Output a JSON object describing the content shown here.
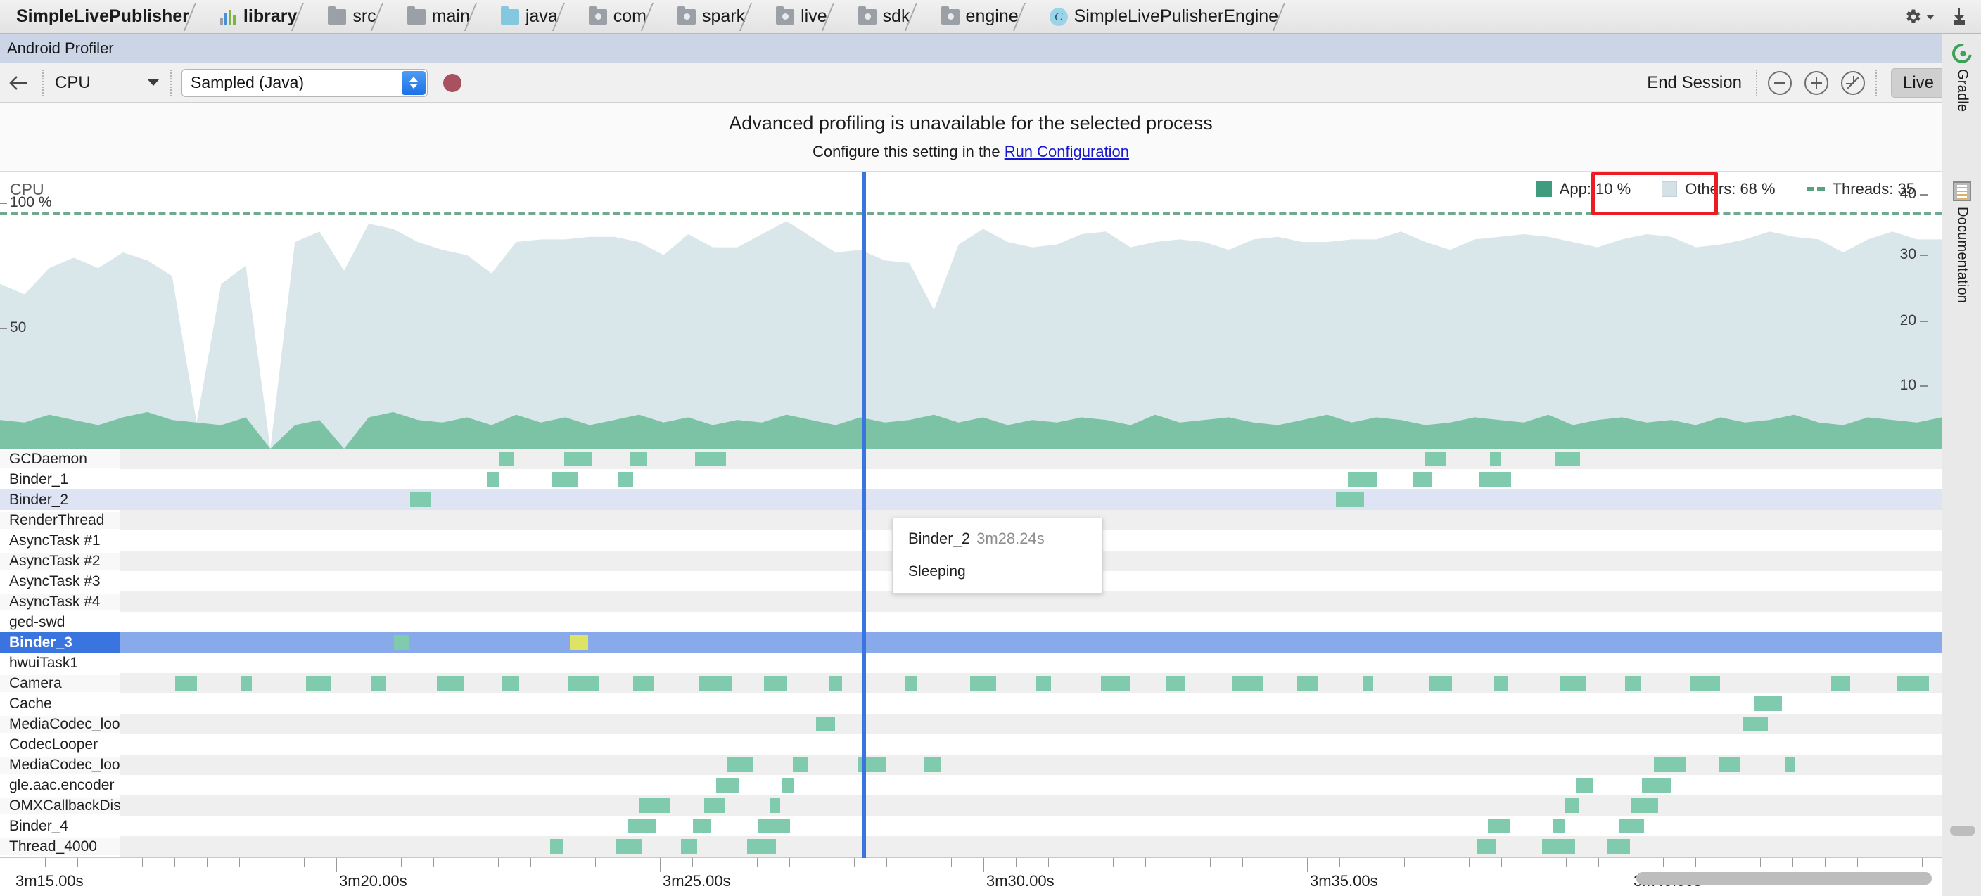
{
  "breadcrumb": [
    {
      "label": "SimpleLivePublisher",
      "icon": "module-icon",
      "bold": true
    },
    {
      "label": "library",
      "icon": "chart-icon",
      "bold": true
    },
    {
      "label": "src",
      "icon": "folder-icon",
      "bold": false
    },
    {
      "label": "main",
      "icon": "folder-icon",
      "bold": false
    },
    {
      "label": "java",
      "icon": "folder-blue-icon",
      "bold": false
    },
    {
      "label": "com",
      "icon": "package-icon",
      "bold": false
    },
    {
      "label": "spark",
      "icon": "package-icon",
      "bold": false
    },
    {
      "label": "live",
      "icon": "package-icon",
      "bold": false
    },
    {
      "label": "sdk",
      "icon": "package-icon",
      "bold": false
    },
    {
      "label": "engine",
      "icon": "package-icon",
      "bold": false
    },
    {
      "label": "SimpleLivePulisherEngine",
      "icon": "class-icon",
      "bold": false
    }
  ],
  "breadcrumb_right": {
    "settings_icon": "gear-icon",
    "settings_caret": "chevron-down-icon",
    "hide_icon": "hide-window-icon"
  },
  "tool_window": {
    "title": "Android Profiler"
  },
  "toolbar": {
    "back_icon": "back-arrow-icon",
    "profiler_type": "CPU",
    "profiler_type_caret": "chevron-down-icon",
    "recording_mode": "Sampled (Java)",
    "record_button": "record-dot",
    "end_session": "End Session",
    "zoom_out_icon": "zoom-out-icon",
    "zoom_in_icon": "zoom-in-icon",
    "reset_zoom_icon": "reset-zoom-icon",
    "live_label": "Live",
    "live_icon": "go-live-icon"
  },
  "banner": {
    "title": "Advanced profiling is unavailable for the selected process",
    "prefix": "Configure this setting in the ",
    "link": "Run Configuration"
  },
  "cpu": {
    "title": "CPU",
    "left_axis": [
      "100 %",
      "50"
    ],
    "right_axis": [
      "40",
      "30",
      "20",
      "10"
    ],
    "legend": [
      {
        "name": "App",
        "value": "App: 10 %",
        "color": "#3f9c7f",
        "type": "swatch"
      },
      {
        "name": "Others",
        "value": "Others: 68 %",
        "color": "#d4e2e8",
        "type": "swatch"
      },
      {
        "name": "Threads",
        "value": "Threads: 35",
        "color": "#5aa182",
        "type": "dashed"
      }
    ],
    "highlight_color": "#ec1c24"
  },
  "chart_data": {
    "type": "area",
    "title": "CPU",
    "xlabel": "",
    "ylabel": "CPU %",
    "ylim": [
      0,
      100
    ],
    "y2lim": [
      0,
      40
    ],
    "y2label": "Threads",
    "grid": false,
    "legend_position": "top-right",
    "x_ticks": [
      "3m15.00s",
      "3m20.00s",
      "3m25.00s",
      "3m30.00s",
      "3m35.00s",
      "3m40.00s"
    ],
    "y_ticks": [
      50,
      100
    ],
    "y2_ticks": [
      10,
      20,
      30,
      40
    ],
    "series": [
      {
        "name": "App",
        "color": "#7bc3a4",
        "values": [
          11,
          10,
          13,
          11,
          9,
          12,
          14,
          11,
          10,
          9,
          12,
          0,
          9,
          11,
          0,
          12,
          14,
          11,
          10,
          12,
          9,
          13,
          10,
          12,
          9,
          11,
          13,
          10,
          12,
          9,
          11,
          10,
          13,
          11,
          9,
          12,
          10,
          11,
          13,
          10,
          12,
          9,
          11,
          10,
          12,
          11,
          9,
          13,
          10,
          11,
          12,
          10,
          9,
          11,
          13,
          10,
          12,
          11,
          9,
          10,
          12,
          11,
          10,
          13,
          9,
          11,
          12,
          10,
          11,
          9,
          12,
          10,
          11,
          13,
          10,
          9,
          12,
          11,
          10,
          12
        ]
      },
      {
        "name": "Others",
        "color": "#d9e6ea",
        "values": [
          52,
          49,
          56,
          62,
          60,
          63,
          58,
          55,
          0,
          54,
          58,
          0,
          70,
          72,
          68,
          74,
          70,
          68,
          66,
          62,
          58,
          66,
          70,
          68,
          72,
          70,
          66,
          64,
          70,
          68,
          66,
          72,
          74,
          70,
          66,
          64,
          62,
          60,
          40,
          68,
          72,
          70,
          66,
          68,
          70,
          72,
          68,
          66,
          70,
          68,
          64,
          70,
          72,
          68,
          66,
          70,
          68,
          72,
          70,
          66,
          68,
          70,
          72,
          68,
          70,
          66,
          68,
          72,
          70,
          68,
          66,
          70,
          72,
          68,
          70,
          66,
          68,
          72,
          70,
          68
        ]
      },
      {
        "name": "Threads",
        "type": "dashed-line",
        "color": "#71a98e",
        "constant": 35
      }
    ]
  },
  "threads": {
    "selected": "Binder_3",
    "rows": [
      {
        "name": "GCDaemon",
        "style": "alt"
      },
      {
        "name": "Binder_1",
        "style": "plain"
      },
      {
        "name": "Binder_2",
        "style": "highlight"
      },
      {
        "name": "RenderThread",
        "style": "alt"
      },
      {
        "name": "AsyncTask #1",
        "style": "plain"
      },
      {
        "name": "AsyncTask #2",
        "style": "alt"
      },
      {
        "name": "AsyncTask #3",
        "style": "plain"
      },
      {
        "name": "AsyncTask #4",
        "style": "alt"
      },
      {
        "name": "ged-swd",
        "style": "plain"
      },
      {
        "name": "Binder_3",
        "style": "selected"
      },
      {
        "name": "hwuiTask1",
        "style": "plain"
      },
      {
        "name": "Camera",
        "style": "alt"
      },
      {
        "name": "Cache",
        "style": "plain"
      },
      {
        "name": "MediaCodec_loop",
        "style": "alt"
      },
      {
        "name": "CodecLooper",
        "style": "plain"
      },
      {
        "name": "MediaCodec_loop",
        "style": "alt"
      },
      {
        "name": "gle.aac.encoder",
        "style": "plain"
      },
      {
        "name": "OMXCallbackDisp",
        "style": "alt"
      },
      {
        "name": "Binder_4",
        "style": "plain"
      },
      {
        "name": "Thread_4000",
        "style": "alt"
      }
    ]
  },
  "tooltip": {
    "thread": "Binder_2",
    "time": "3m28.24s",
    "state": "Sleeping"
  },
  "time_axis": {
    "labels": [
      "3m15.00s",
      "3m20.00s",
      "3m25.00s",
      "3m30.00s",
      "3m35.00s",
      "3m40.00s"
    ]
  },
  "right_dock": [
    {
      "label": "Gradle",
      "icon": "gradle-icon"
    },
    {
      "label": "Documentation",
      "icon": "documentation-icon"
    }
  ]
}
